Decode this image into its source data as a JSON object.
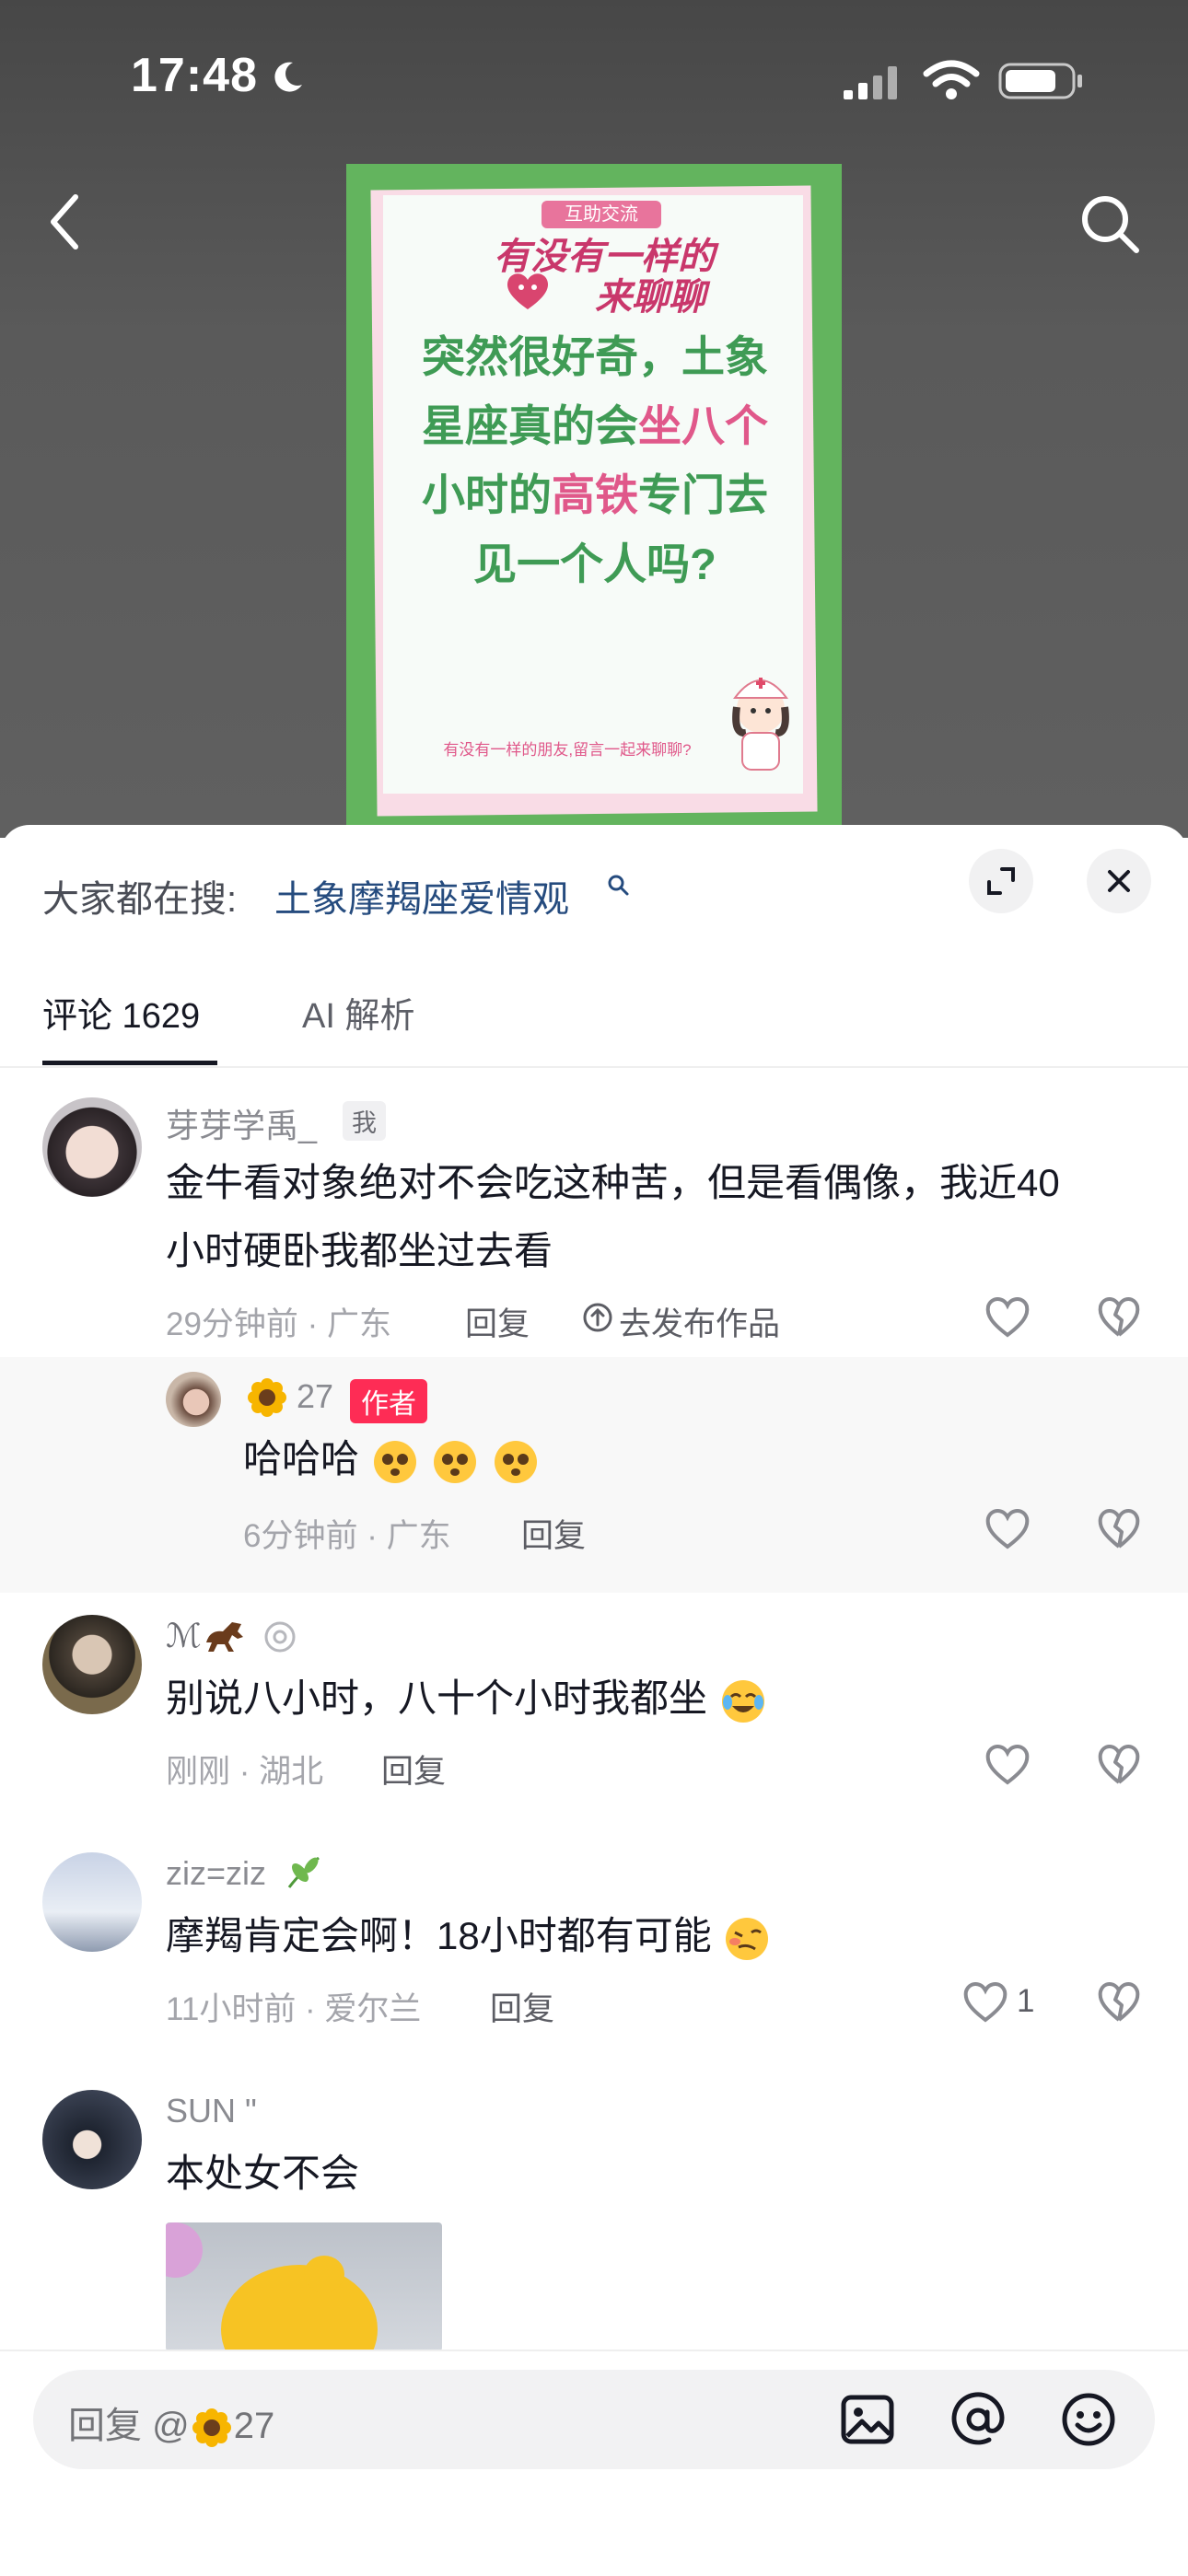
{
  "status_bar": {
    "time": "17:48"
  },
  "poster": {
    "tag": "互助交流",
    "headline_line1": "有没有一样的",
    "headline_line2": "来聊聊",
    "body_parts": [
      {
        "t": "突然很好奇，土象星座真的会",
        "c": "g"
      },
      {
        "t": "坐八个",
        "c": "p"
      },
      {
        "t": "小时的",
        "c": "g"
      },
      {
        "t": "高铁",
        "c": "p"
      },
      {
        "t": "专门去见一个人吗?",
        "c": "g"
      }
    ],
    "footer": "有没有一样的朋友,留言一起来聊聊?"
  },
  "hot_search": {
    "label": "大家都在搜:",
    "query": "土象摩羯座爱情观"
  },
  "tabs": {
    "comments": "评论 1629",
    "ai": "AI 解析"
  },
  "comments": [
    {
      "user": "芽芽学禹_",
      "badge": "我",
      "text_line1": "金牛看对象绝对不会吃这种苦，但是看偶像，我近40",
      "text_line2": "小时硬卧我都坐过去看",
      "meta": "29分钟前 · 广东",
      "reply": "回复",
      "publish": "去发布作品"
    },
    {
      "user": "27",
      "badge": "作者",
      "text": "哈哈哈",
      "meta": "6分钟前 · 广东",
      "reply": "回复"
    },
    {
      "user": "ℳ",
      "text": "别说八小时，八十个小时我都坐",
      "meta": "刚刚 · 湖北",
      "reply": "回复"
    },
    {
      "user": "ziz=ziz",
      "text": "摩羯肯定会啊！18小时都有可能",
      "meta": "11小时前 · 爱尔兰",
      "reply": "回复",
      "likes": "1"
    },
    {
      "user": "SUN \"",
      "text": "本处女不会"
    }
  ],
  "input": {
    "placeholder_prefix": "回复 @",
    "placeholder_user": "27"
  },
  "colors": {
    "accent": "#fe2c55",
    "link": "#254b7e",
    "poster_green": "#63b45e",
    "poster_pink": "#e0588a"
  }
}
